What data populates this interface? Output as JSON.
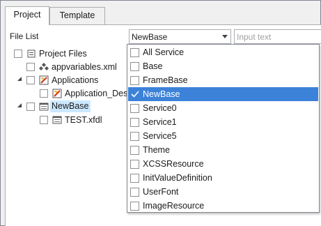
{
  "tabs": [
    {
      "label": "Project",
      "active": true
    },
    {
      "label": "Template",
      "active": false
    }
  ],
  "file_list": {
    "label": "File List",
    "selected_value": "NewBase",
    "search_placeholder": "Input text"
  },
  "tree": {
    "items": [
      {
        "label": "Project Files",
        "icon": "project-icon",
        "expanded": null
      },
      {
        "label": "appvariables.xml",
        "icon": "variables-icon",
        "expanded": null
      },
      {
        "label": "Applications",
        "icon": "applications-icon",
        "expanded": true
      },
      {
        "label": "Application_Desk",
        "icon": "application-icon",
        "expanded": null
      },
      {
        "label": "NewBase",
        "icon": "form-icon",
        "expanded": true,
        "selected": true
      },
      {
        "label": "TEST.xfdl",
        "icon": "form-icon",
        "expanded": null
      }
    ]
  },
  "dropdown": {
    "items": [
      {
        "label": "All Service",
        "checked": false
      },
      {
        "label": "Base",
        "checked": false
      },
      {
        "label": "FrameBase",
        "checked": false
      },
      {
        "label": "NewBase",
        "checked": true
      },
      {
        "label": "Service0",
        "checked": false
      },
      {
        "label": "Service1",
        "checked": false
      },
      {
        "label": "Service5",
        "checked": false
      },
      {
        "label": "Theme",
        "checked": false
      },
      {
        "label": "XCSSResource",
        "checked": false
      },
      {
        "label": "InitValueDefinition",
        "checked": false
      },
      {
        "label": "UserFont",
        "checked": false
      },
      {
        "label": "ImageResource",
        "checked": false
      }
    ]
  },
  "colors": {
    "selection": "#3c82d8",
    "tree_selection": "#cce8ff"
  }
}
